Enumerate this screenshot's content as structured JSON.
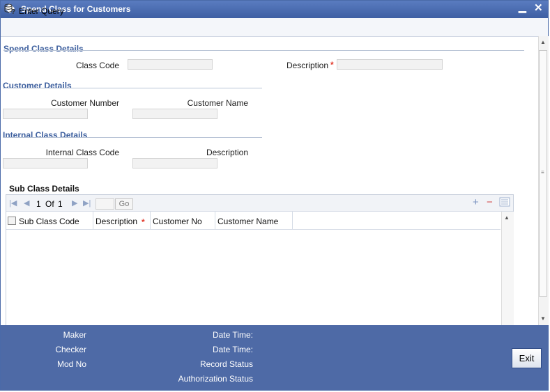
{
  "window": {
    "title": "Spend Class for Customers"
  },
  "toolbar": {
    "enter_query": "Enter Query"
  },
  "spend_class": {
    "section": "Spend Class Details",
    "class_code_label": "Class Code",
    "class_code_value": "",
    "description_label": "Description",
    "description_value": "",
    "required_mark": "*"
  },
  "customer": {
    "section": "Customer Details",
    "number_label": "Customer Number",
    "number_value": "",
    "name_label": "Customer Name",
    "name_value": ""
  },
  "internal_class": {
    "section": "Internal Class Details",
    "code_label": "Internal Class Code",
    "code_value": "",
    "description_label": "Description",
    "description_value": ""
  },
  "sub_class": {
    "title": "Sub Class Details",
    "pager": {
      "current": "1",
      "of_label": "Of",
      "total": "1",
      "go_label": "Go"
    },
    "columns": [
      "Sub Class Code",
      "Description",
      "Customer No",
      "Customer Name"
    ],
    "required_mark": "*",
    "rows": []
  },
  "footer": {
    "maker": "Maker",
    "checker": "Checker",
    "mod_no": "Mod No",
    "date_time_1": "Date Time:",
    "date_time_2": "Date Time:",
    "record_status": "Record Status",
    "authorization_status": "Authorization Status",
    "exit_label": "Exit"
  }
}
